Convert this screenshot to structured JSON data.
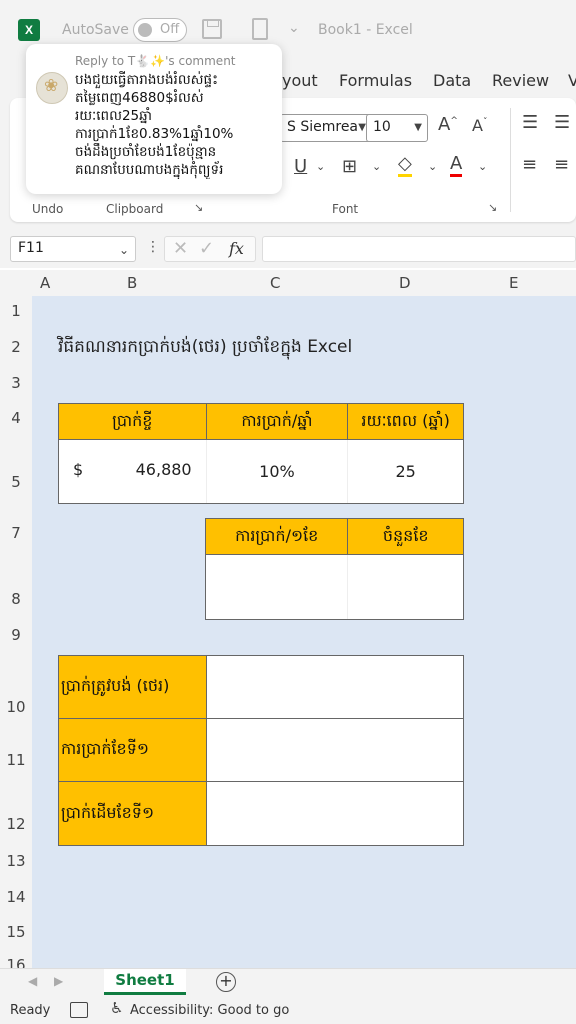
{
  "titlebar": {
    "autosave_label": "AutoSave",
    "autosave_state": "Off",
    "book_title": "Book1  -  Excel"
  },
  "ribbon": {
    "tabs": [
      "yout",
      "Formulas",
      "Data",
      "Review",
      "V"
    ],
    "font_name": "S Siemrea",
    "font_size": "10",
    "groups": {
      "undo": "Undo",
      "clipboard": "Clipboard",
      "font": "Font"
    }
  },
  "comment": {
    "reply_to": "Reply to T🐇✨'s comment",
    "lines": [
      "បងជួយធ្វើតារាងបង់រំលស់ផ្ទះ",
      "តម្លៃពេញ46880$រំលស់",
      "រយៈពេល25ឆ្នាំ",
      "ការប្រាក់1ខែ0.83%1ឆ្នាំ10%",
      "ចង់ដឹងប្រចាំខែបង់1ខែប៉ុន្មាន",
      "គណនាបែបណាបងក្នុងកុំព្យូទ័រ"
    ]
  },
  "formula_bar": {
    "name_box": "F11",
    "fx": "fx",
    "formula": ""
  },
  "columns": [
    "A",
    "B",
    "C",
    "D",
    "E"
  ],
  "rows": [
    "1",
    "2",
    "3",
    "4",
    "5",
    "7",
    "8",
    "9",
    "10",
    "11",
    "12",
    "13",
    "14",
    "15",
    "16"
  ],
  "sheet": {
    "heading": "វិធីគណនារកប្រាក់បង់(ថេរ) ប្រចាំខែក្នុង Excel",
    "table1": {
      "headers": [
        "ប្រាក់ខ្ចី",
        "ការប្រាក់/ឆ្នាំ",
        "រយៈពេល (ឆ្នាំ)"
      ],
      "currency": "$",
      "loan": "46,880",
      "rate": "10%",
      "years": "25"
    },
    "table2": {
      "headers": [
        "ការប្រាក់/១ខែ",
        "ចំនួនខែ"
      ],
      "values": [
        "",
        ""
      ]
    },
    "table3": {
      "labels": [
        "ប្រាក់ត្រូវបង់ (ថេរ)",
        "ការប្រាក់ខែទី១",
        "ប្រាក់ដើមខែទី១"
      ],
      "values": [
        "",
        "",
        ""
      ]
    }
  },
  "sheet_tabs": {
    "active": "Sheet1",
    "add": "+"
  },
  "status": {
    "ready": "Ready",
    "accessibility": "Accessibility: Good to go"
  },
  "colors": {
    "excel_green": "#107c41",
    "header_fill": "#ffc000",
    "sheet_bg": "#dce6f3"
  }
}
